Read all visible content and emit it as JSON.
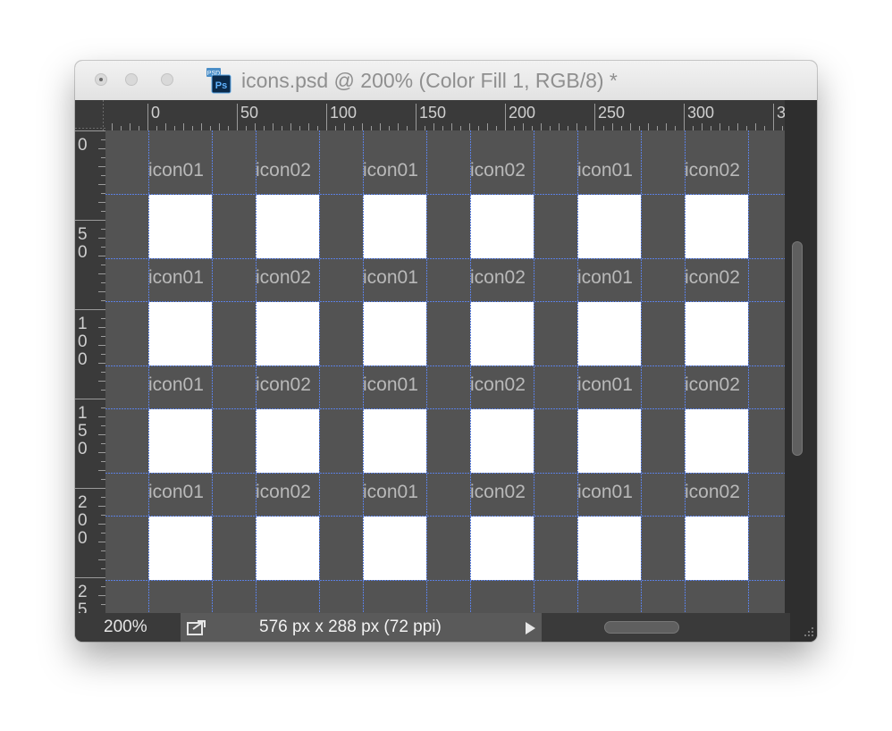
{
  "window": {
    "title": "icons.psd @ 200% (Color Fill 1, RGB/8) *",
    "file_badge": "PSD",
    "app_badge": "Ps"
  },
  "rulers": {
    "horizontal_labels": [
      "0",
      "50",
      "100",
      "150",
      "200",
      "250",
      "300",
      "3"
    ],
    "vertical_labels": [
      [
        "0"
      ],
      [
        "5",
        "0"
      ],
      [
        "1",
        "0",
        "0"
      ],
      [
        "1",
        "5",
        "0"
      ],
      [
        "2",
        "0",
        "0"
      ],
      [
        "2",
        "5"
      ]
    ]
  },
  "canvas": {
    "rows": [
      [
        "icon01",
        "icon02",
        "icon01",
        "icon02",
        "icon01",
        "icon02"
      ],
      [
        "icon01",
        "icon02",
        "icon01",
        "icon02",
        "icon01",
        "icon02"
      ],
      [
        "icon01",
        "icon02",
        "icon01",
        "icon02",
        "icon01",
        "icon02"
      ],
      [
        "icon01",
        "icon02",
        "icon01",
        "icon02",
        "icon01",
        "icon02"
      ]
    ],
    "background_color": "#535353",
    "cell_color": "#ffffff",
    "guide_color": "#5b7fe0"
  },
  "status": {
    "zoom": "200%",
    "doc_info": "576 px x 288 px (72 ppi)"
  }
}
